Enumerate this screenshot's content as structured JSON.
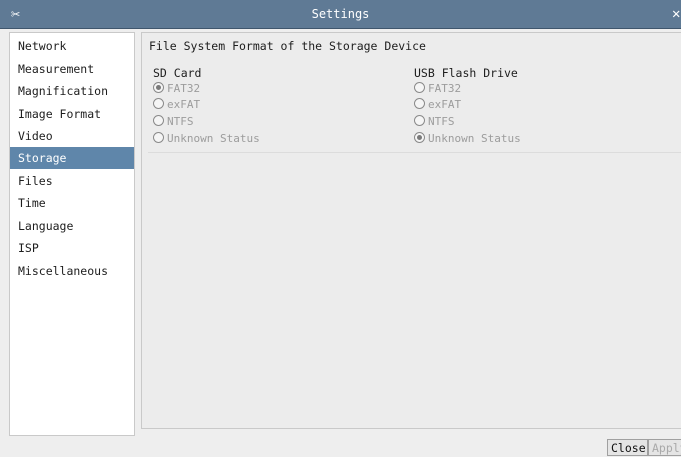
{
  "window": {
    "title": "Settings",
    "icon": "tools-icon",
    "close_icon": "close-icon"
  },
  "sidebar": {
    "items": [
      {
        "label": "Network"
      },
      {
        "label": "Measurement"
      },
      {
        "label": "Magnification"
      },
      {
        "label": "Image Format"
      },
      {
        "label": "Video"
      },
      {
        "label": "Storage",
        "selected": true
      },
      {
        "label": "Files"
      },
      {
        "label": "Time"
      },
      {
        "label": "Language"
      },
      {
        "label": "ISP"
      },
      {
        "label": "Miscellaneous"
      }
    ]
  },
  "panel": {
    "heading": "File System Format of the Storage Device",
    "sd_card": {
      "label": "SD Card",
      "options": [
        "FAT32",
        "exFAT",
        "NTFS",
        "Unknown Status"
      ],
      "selected": "FAT32"
    },
    "usb": {
      "label": "USB Flash Drive",
      "options": [
        "FAT32",
        "exFAT",
        "NTFS",
        "Unknown Status"
      ],
      "selected": "Unknown Status"
    }
  },
  "footer": {
    "close_label": "Close",
    "apply_label": "Apply"
  },
  "colors": {
    "titlebar": "#5f7a95",
    "selection": "#5f86aa"
  }
}
